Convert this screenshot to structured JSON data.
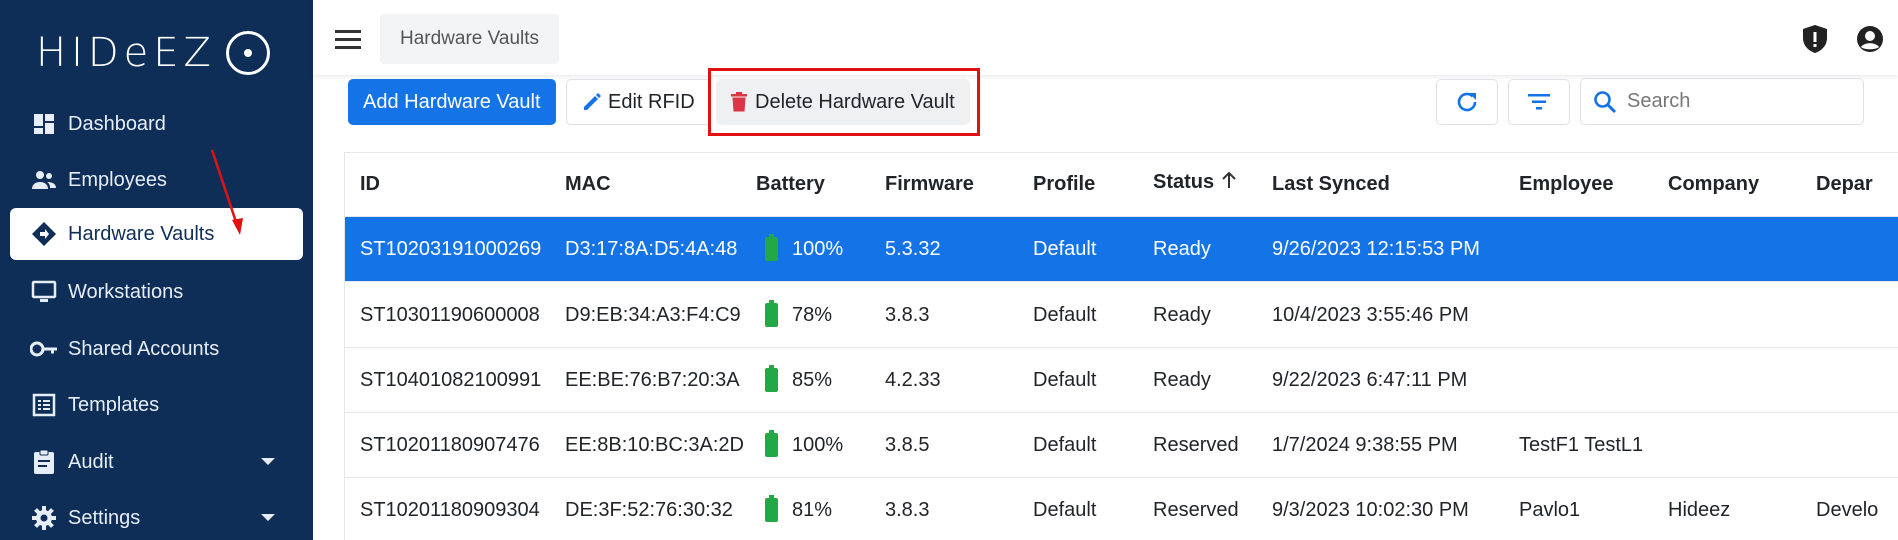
{
  "brand": {
    "logo_text": "HIDeEZ"
  },
  "sidebar": {
    "items": [
      {
        "label": "Dashboard",
        "icon": "dashboard-icon"
      },
      {
        "label": "Employees",
        "icon": "people-icon"
      },
      {
        "label": "Hardware Vaults",
        "icon": "diamond-arrow-icon",
        "active": true
      },
      {
        "label": "Workstations",
        "icon": "monitor-icon"
      },
      {
        "label": "Shared Accounts",
        "icon": "key-icon"
      },
      {
        "label": "Templates",
        "icon": "list-icon"
      },
      {
        "label": "Audit",
        "icon": "clipboard-icon",
        "has_dropdown": true
      },
      {
        "label": "Settings",
        "icon": "gear-icon",
        "has_dropdown": true
      }
    ]
  },
  "header": {
    "breadcrumb": "Hardware Vaults",
    "icons": [
      "menu-icon",
      "shield-alert-icon",
      "account-icon"
    ]
  },
  "toolbar": {
    "add_label": "Add Hardware Vault",
    "edit_rfid_label": "Edit RFID",
    "delete_label": "Delete Hardware Vault",
    "search_placeholder": "Search"
  },
  "colors": {
    "sidebar_bg": "#0f2e57",
    "primary": "#1473e6",
    "battery": "#22a846",
    "annotation": "#e11111"
  },
  "table": {
    "columns": [
      "ID",
      "MAC",
      "Battery",
      "Firmware",
      "Profile",
      "Status",
      "Last Synced",
      "Employee",
      "Company",
      "Depar"
    ],
    "sorted_column": "Status",
    "rows": [
      {
        "id": "ST10203191000269",
        "mac": "D3:17:8A:D5:4A:48",
        "battery": "100%",
        "firmware": "5.3.32",
        "profile": "Default",
        "status": "Ready",
        "last_synced": "9/26/2023 12:15:53 PM",
        "employee": "",
        "company": "",
        "department": "",
        "selected": true
      },
      {
        "id": "ST10301190600008",
        "mac": "D9:EB:34:A3:F4:C9",
        "battery": "78%",
        "firmware": "3.8.3",
        "profile": "Default",
        "status": "Ready",
        "last_synced": "10/4/2023 3:55:46 PM",
        "employee": "",
        "company": "",
        "department": ""
      },
      {
        "id": "ST10401082100991",
        "mac": "EE:BE:76:B7:20:3A",
        "battery": "85%",
        "firmware": "4.2.33",
        "profile": "Default",
        "status": "Ready",
        "last_synced": "9/22/2023 6:47:11 PM",
        "employee": "",
        "company": "",
        "department": ""
      },
      {
        "id": "ST10201180907476",
        "mac": "EE:8B:10:BC:3A:2D",
        "battery": "100%",
        "firmware": "3.8.5",
        "profile": "Default",
        "status": "Reserved",
        "last_synced": "1/7/2024 9:38:55 PM",
        "employee": "TestF1 TestL1",
        "company": "",
        "department": ""
      },
      {
        "id": "ST10201180909304",
        "mac": "DE:3F:52:76:30:32",
        "battery": "81%",
        "firmware": "3.8.3",
        "profile": "Default",
        "status": "Reserved",
        "last_synced": "9/3/2023 10:02:30 PM",
        "employee": "Pavlo1",
        "company": "Hideez",
        "department": "Develo"
      }
    ]
  }
}
